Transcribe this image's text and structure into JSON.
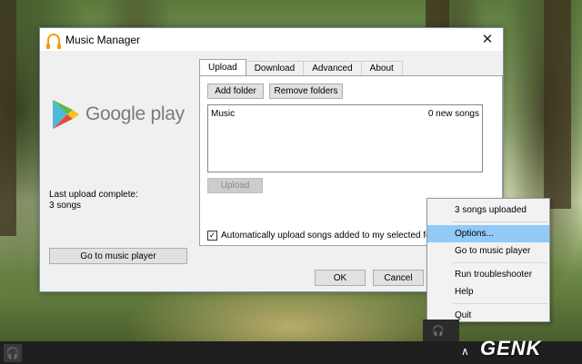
{
  "window": {
    "title": "Music Manager",
    "close_glyph": "✕"
  },
  "branding": {
    "logo_text": "Google play"
  },
  "status": {
    "last_upload_line1": "Last upload complete:",
    "last_upload_line2": "3 songs"
  },
  "left_panel": {
    "go_to_player_label": "Go to music player"
  },
  "tabs": [
    {
      "label": "Upload",
      "active": true
    },
    {
      "label": "Download",
      "active": false
    },
    {
      "label": "Advanced",
      "active": false
    },
    {
      "label": "About",
      "active": false
    }
  ],
  "upload_tab": {
    "add_folder_label": "Add folder",
    "remove_folders_label": "Remove folders",
    "folders": [
      {
        "name": "Music",
        "status": "0 new songs"
      }
    ],
    "upload_button_label": "Upload",
    "auto_upload_checked": true,
    "auto_upload_label": "Automatically upload songs added to my selected folders"
  },
  "dialog_buttons": {
    "ok_label": "OK",
    "cancel_label": "Cancel"
  },
  "context_menu": {
    "items": [
      {
        "label": "3 songs uploaded",
        "highlighted": false
      },
      {
        "label": "Options...",
        "highlighted": true
      },
      {
        "label": "Go to music player",
        "highlighted": false
      },
      {
        "label": "Run troubleshooter",
        "highlighted": false
      },
      {
        "label": "Help",
        "highlighted": false
      },
      {
        "label": "Quit",
        "highlighted": false
      }
    ]
  },
  "taskbar": {
    "headphones_glyph": "🎧",
    "chevron_glyph": "∧"
  },
  "watermark": {
    "text": "GENK"
  },
  "colors": {
    "accent_orange": "#f39c12",
    "menu_highlight": "#91c9f7"
  }
}
